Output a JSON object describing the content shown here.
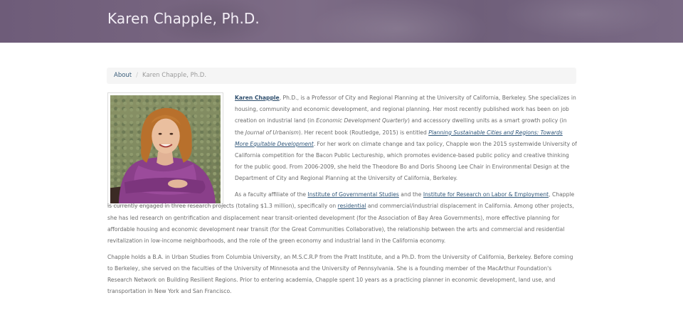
{
  "header": {
    "title": "Karen Chapple, Ph.D."
  },
  "breadcrumb": {
    "parent": "About",
    "separator": "/",
    "current": "Karen Chapple, Ph.D."
  },
  "photo": {
    "icon": "portrait-photo"
  },
  "bio": {
    "p1": {
      "name_link": "Karen Chapple",
      "t1": ", Ph.D., is a Professor of City and Regional Planning at the University of California, Berkeley. She specializes in housing, community and economic development, and regional planning. Her most recently published work has been on job creation on industrial land (in ",
      "journal1": "Economic Development Quarterly",
      "t2": ") and accessory dwelling units as a smart growth policy (in the ",
      "journal2": "Journal of Urbanism",
      "t3": "). Her recent book (Routledge, 2015) is entitled ",
      "book_link": "Planning Sustainable Cities and Regions: Towards More Equitable Development",
      "t4": ". For her work on climate change and tax policy, Chapple won the 2015 systemwide University of California competition for the Bacon Public Lectureship, which promotes evidence-based public policy and creative thinking for the public good. From 2006-2009, she held the Theodore Bo and Doris Shoong Lee Chair in Environmental Design at the Department of City and Regional Planning at the University of California, Berkeley."
    },
    "p2": {
      "t1": "As a faculty affiliate of the ",
      "link1": "Institute of Governmental Studies",
      "t2": " and the ",
      "link2": "Institute for Research on Labor & Employment",
      "t3": ", Chapple is currently engaged in three research projects (totaling $1.3 million), specifically on ",
      "link3": "residential",
      "t4": " and commercial/industrial displacement in California. Among other projects, she has led research on gentrification and displacement near transit-oriented development (for the Association of Bay Area Governments), more effective planning for affordable housing and economic development near transit (for the Great Communities Collaborative), the relationship between the arts and commercial and residential revitalization in low-income neighborhoods, and the role of the green economy and industrial land in the California economy."
    },
    "p3": "Chapple holds a B.A. in Urban Studies from Columbia University, an M.S.C.R.P from the Pratt Institute, and a Ph.D. from the University of California, Berkeley. Before coming to Berkeley, she served on the faculties of the University of Minnesota and the University of Pennsylvania. She is a founding member of the MacArthur Foundation's Research Network on Building Resilient Regions. Prior to entering academia, Chapple spent 10 years as a practicing planner in economic development, land use, and transportation in New York and San Francisco."
  },
  "colors": {
    "banner": "#76647f",
    "banner_text": "#f3eef6",
    "link": "#2f5679",
    "body_text": "#6b6b6b",
    "breadcrumb_bg": "#f5f5f5"
  }
}
